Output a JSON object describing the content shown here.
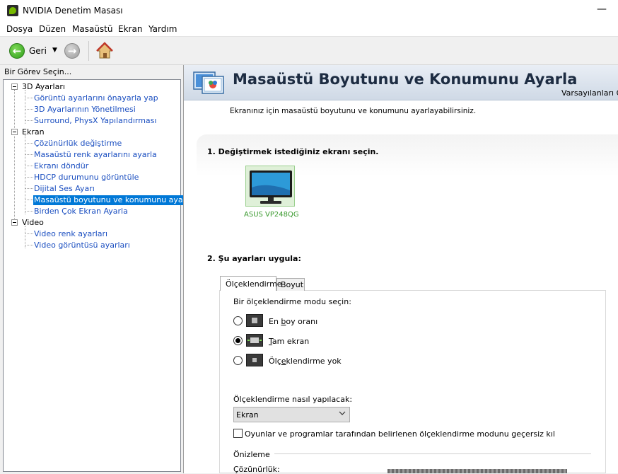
{
  "window": {
    "title": "NVIDIA Denetim Masası",
    "minimize_glyph": "—"
  },
  "menu": {
    "items": [
      "Dosya",
      "Düzen",
      "Masaüstü",
      "Ekran",
      "Yardım"
    ]
  },
  "toolbar": {
    "back_label": "Geri",
    "dropdown_glyph": "▼",
    "back_arrow": "←",
    "forward_arrow": "→"
  },
  "left": {
    "header": "Bir Görev Seçin...",
    "groups": [
      {
        "label": "3D Ayarları",
        "items": [
          "Görüntü ayarlarını önayarla yap",
          "3D Ayarlarının Yönetilmesi",
          "Surround, PhysX Yapılandırması"
        ]
      },
      {
        "label": "Ekran",
        "items": [
          "Çözünürlük değiştirme",
          "Masaüstü renk ayarlarını ayarla",
          "Ekranı döndür",
          "HDCP durumunu görüntüle",
          "Dijital Ses Ayarı",
          "Masaüstü boyutunu ve konumunu ayarla",
          "Birden Çok Ekran Ayarla"
        ]
      },
      {
        "label": "Video",
        "items": [
          "Video renk ayarları",
          "Video görüntüsü ayarları"
        ]
      }
    ]
  },
  "page": {
    "title": "Masaüstü Boyutunu ve Konumunu Ayarla",
    "defaults_link": "Varsayılanları G",
    "description": "Ekranınız için masaüstü boyutunu ve konumunu ayarlayabilirsiniz.",
    "step1": "1. Değiştirmek istediğiniz ekranı seçin.",
    "monitor_name": "ASUS VP248QG",
    "step2": "2. Şu ayarları uygula:",
    "tabs": [
      "Ölçeklendirme",
      "Boyut"
    ],
    "scaling_mode_prompt": "Bir ölçeklendirme modu seçin:",
    "modes": [
      {
        "label_pre": "En ",
        "label_ul": "b",
        "label_post": "oy oranı",
        "checked": false
      },
      {
        "label_pre": "",
        "label_ul": "T",
        "label_post": "am ekran",
        "checked": true
      },
      {
        "label_pre": "Ölç",
        "label_ul": "e",
        "label_post": "klendirme yok",
        "checked": false
      }
    ],
    "how_label": "Ölçeklendirme nasıl yapılacak:",
    "how_value": "Ekran",
    "override_label": "Oyunlar ve programlar tarafından belirlenen ölçeklendirme modunu geçersiz kıl",
    "override_checked": false,
    "preview_label": "Önizleme",
    "resolution_label": "Çözünürlük:"
  },
  "colors": {
    "link": "#1a4ec0",
    "selected": "#0078d7",
    "nvidia_green": "#76b900",
    "monitor_label": "#3a9a2e"
  }
}
